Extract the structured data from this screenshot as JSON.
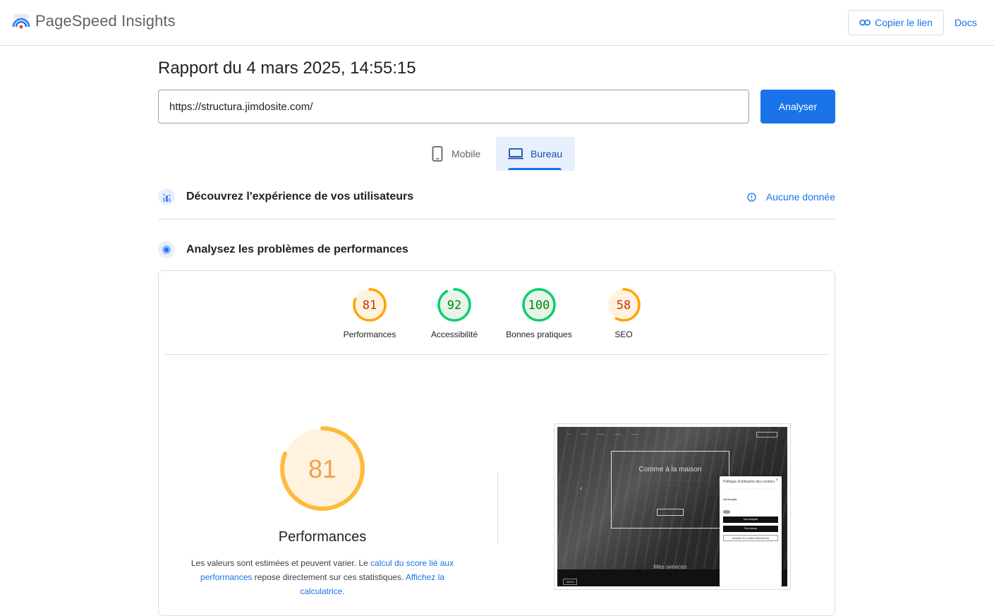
{
  "header": {
    "app_title": "PageSpeed Insights",
    "copy_link_label": "Copier le lien",
    "docs_label": "Docs"
  },
  "report": {
    "title": "Rapport du 4 mars 2025, 14:55:15",
    "url_value": "https://structura.jimdosite.com/",
    "analyze_label": "Analyser"
  },
  "tabs": [
    {
      "label": "Mobile",
      "icon": "phone-icon",
      "selected": false
    },
    {
      "label": "Bureau",
      "icon": "laptop-icon",
      "selected": true
    }
  ],
  "sections": {
    "experience_title": "Découvrez l'expérience de vos utilisateurs",
    "no_data_label": "Aucune donnée",
    "performance_title": "Analysez les problèmes de performances"
  },
  "scores": [
    {
      "label": "Performances",
      "value": 81,
      "status": "average"
    },
    {
      "label": "Accessibilité",
      "value": 92,
      "status": "pass"
    },
    {
      "label": "Bonnes pratiques",
      "value": 100,
      "status": "pass"
    },
    {
      "label": "SEO",
      "value": 58,
      "status": "average"
    }
  ],
  "main_gauge": {
    "value": "81",
    "title": "Performances",
    "desc_prefix": "Les valeurs sont estimées et peuvent varier. Le ",
    "link1": "calcul du score lié aux performances",
    "desc_middle": " repose directement sur ces statistiques. ",
    "link2": "Affichez la calculatrice",
    "desc_suffix": "."
  },
  "screenshot": {
    "hero_title": "Comme à la maison",
    "services_title": "Mes services",
    "cookie_title": "Politique d'utilisation des cookies",
    "cookie_read_more": "Lire la suite",
    "accept_all": "Tout accepter",
    "refuse": "Tout refuser",
    "accept_selected": "Accepter les cookies sélectionnés"
  },
  "colors": {
    "accent": "#1a73e8",
    "pass": "#0cce6b",
    "pass_text": "#008800",
    "average": "#ffa400",
    "average_text": "#c33300",
    "average_bg": "#fff3e0",
    "pass_bg": "#e6f4ea"
  }
}
